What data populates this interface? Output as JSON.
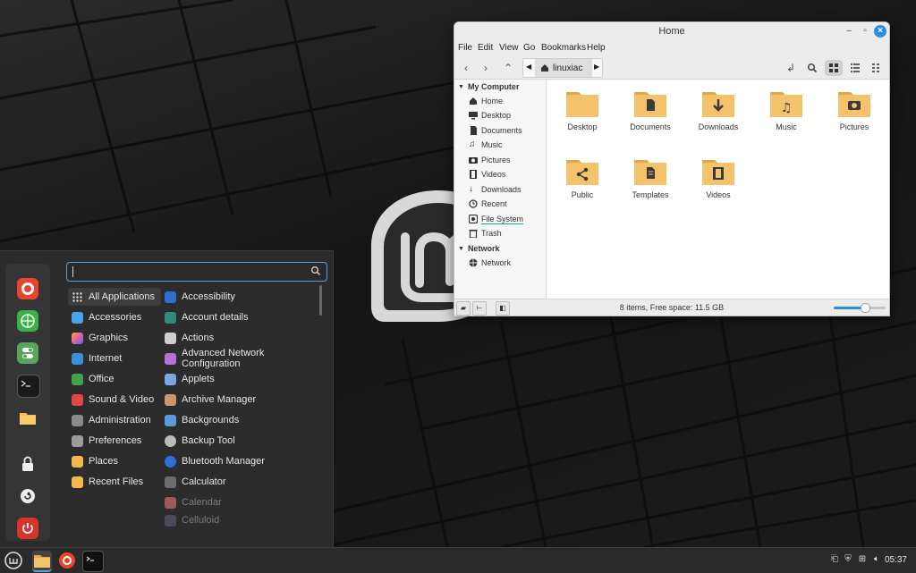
{
  "desktop": {
    "logo_icon": "linux-mint-logo"
  },
  "menu": {
    "search": {
      "value": "",
      "placeholder": ""
    },
    "favorites": [
      {
        "name": "firefox",
        "color": "#e8452c"
      },
      {
        "name": "web-browser",
        "color": "#3ab14a"
      },
      {
        "name": "settings-toggle",
        "color": "#57a65e"
      },
      {
        "name": "terminal",
        "color": "#1a1a1a"
      },
      {
        "name": "files",
        "color": "#f4c04f"
      },
      {
        "name": "lock-screen",
        "color": "#2c2c2c"
      },
      {
        "name": "logout",
        "color": "#2c2c2c"
      },
      {
        "name": "shutdown",
        "color": "#d9332b"
      }
    ],
    "categories": [
      {
        "label": "All Applications",
        "icon": "grid-icon",
        "color": "#cccccc",
        "active": true
      },
      {
        "label": "Accessories",
        "icon": "accessories-icon",
        "color": "#4aa3e8"
      },
      {
        "label": "Graphics",
        "icon": "graphics-icon",
        "color": "#e05fa7"
      },
      {
        "label": "Internet",
        "icon": "internet-icon",
        "color": "#3a8fd8"
      },
      {
        "label": "Office",
        "icon": "office-icon",
        "color": "#3fa34d"
      },
      {
        "label": "Sound & Video",
        "icon": "sound-video-icon",
        "color": "#e04848"
      },
      {
        "label": "Administration",
        "icon": "administration-icon",
        "color": "#8b8b8b"
      },
      {
        "label": "Preferences",
        "icon": "preferences-icon",
        "color": "#9c9c9c"
      },
      {
        "label": "Places",
        "icon": "places-icon",
        "color": "#f1b94a"
      },
      {
        "label": "Recent Files",
        "icon": "recent-files-icon",
        "color": "#f1b94a"
      }
    ],
    "apps": [
      {
        "label": "Accessibility",
        "icon": "accessibility-icon",
        "color": "#2d6fd0"
      },
      {
        "label": "Account details",
        "icon": "account-details-icon",
        "color": "#2f8c7b"
      },
      {
        "label": "Actions",
        "icon": "actions-icon",
        "color": "#cfcfcf"
      },
      {
        "label": "Advanced Network Configuration",
        "icon": "network-config-icon",
        "color": "#b074d6"
      },
      {
        "label": "Applets",
        "icon": "applets-icon",
        "color": "#79a8e0"
      },
      {
        "label": "Archive Manager",
        "icon": "archive-manager-icon",
        "color": "#c49a6c"
      },
      {
        "label": "Backgrounds",
        "icon": "backgrounds-icon",
        "color": "#5b9ad8"
      },
      {
        "label": "Backup Tool",
        "icon": "backup-tool-icon",
        "color": "#bcbcbc"
      },
      {
        "label": "Bluetooth Manager",
        "icon": "bluetooth-icon",
        "color": "#2e6fd6"
      },
      {
        "label": "Calculator",
        "icon": "calculator-icon",
        "color": "#6c6c6c"
      },
      {
        "label": "Calendar",
        "icon": "calendar-icon",
        "color": "#d45050",
        "dim": true
      },
      {
        "label": "Celluloid",
        "icon": "celluloid-icon",
        "color": "#5a5a7a",
        "dim": true
      }
    ]
  },
  "filemanager": {
    "title": "Home",
    "menubar": [
      "File",
      "Edit",
      "View",
      "Go",
      "Bookmarks",
      "Help"
    ],
    "path_segment": "linuxiac",
    "sidebar": {
      "my_computer_header": "My Computer",
      "items": [
        {
          "label": "Home",
          "icon": "home-icon"
        },
        {
          "label": "Desktop",
          "icon": "desktop-icon"
        },
        {
          "label": "Documents",
          "icon": "documents-icon"
        },
        {
          "label": "Music",
          "icon": "music-icon"
        },
        {
          "label": "Pictures",
          "icon": "pictures-icon"
        },
        {
          "label": "Videos",
          "icon": "videos-icon"
        },
        {
          "label": "Downloads",
          "icon": "downloads-icon"
        },
        {
          "label": "Recent",
          "icon": "recent-icon"
        },
        {
          "label": "File System",
          "icon": "filesystem-icon",
          "focus": true
        },
        {
          "label": "Trash",
          "icon": "trash-icon"
        }
      ],
      "network_header": "Network",
      "network_items": [
        {
          "label": "Network",
          "icon": "network-icon"
        }
      ]
    },
    "files": [
      {
        "name": "Desktop",
        "glyph": ""
      },
      {
        "name": "Documents",
        "glyph": "▮"
      },
      {
        "name": "Downloads",
        "glyph": "↓"
      },
      {
        "name": "Music",
        "glyph": "♫"
      },
      {
        "name": "Pictures",
        "glyph": "◉"
      },
      {
        "name": "Public",
        "glyph": "⋖"
      },
      {
        "name": "Templates",
        "glyph": "▯"
      },
      {
        "name": "Videos",
        "glyph": "▦"
      }
    ],
    "status_text": "8 items, Free space: 11.5 GB",
    "zoom_level": 0.6,
    "colors": {
      "accent": "#2d8ee0",
      "folder": "#f3c26b",
      "folder_dark": "#e3a848"
    }
  },
  "taskbar": {
    "clock": "05:37",
    "items": [
      "menu-button",
      "files",
      "firefox",
      "terminal"
    ]
  }
}
